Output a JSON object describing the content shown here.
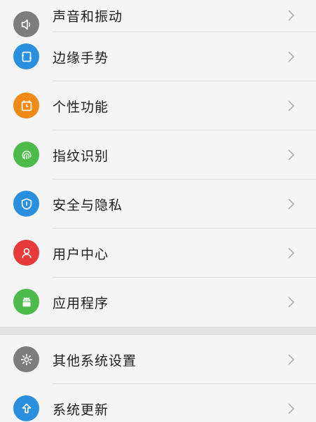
{
  "colors": {
    "gray": "#7d7d7d",
    "blue": "#2b8fe0",
    "orange": "#f08a16",
    "green": "#4cbb4a",
    "red": "#e73a3a",
    "chevron": "#b5b5b5"
  },
  "settings": {
    "group1": [
      {
        "label": "声音和振动",
        "icon": "speaker-icon",
        "color": "gray"
      },
      {
        "label": "边缘手势",
        "icon": "edge-gesture-icon",
        "color": "blue"
      },
      {
        "label": "个性功能",
        "icon": "personal-feature-icon",
        "color": "orange"
      },
      {
        "label": "指纹识别",
        "icon": "fingerprint-icon",
        "color": "green"
      },
      {
        "label": "安全与隐私",
        "icon": "shield-icon",
        "color": "blue"
      },
      {
        "label": "用户中心",
        "icon": "user-icon",
        "color": "red"
      },
      {
        "label": "应用程序",
        "icon": "android-icon",
        "color": "green"
      }
    ],
    "group2": [
      {
        "label": "其他系统设置",
        "icon": "gear-icon",
        "color": "gray"
      },
      {
        "label": "系统更新",
        "icon": "update-arrow-icon",
        "color": "blue"
      }
    ]
  }
}
